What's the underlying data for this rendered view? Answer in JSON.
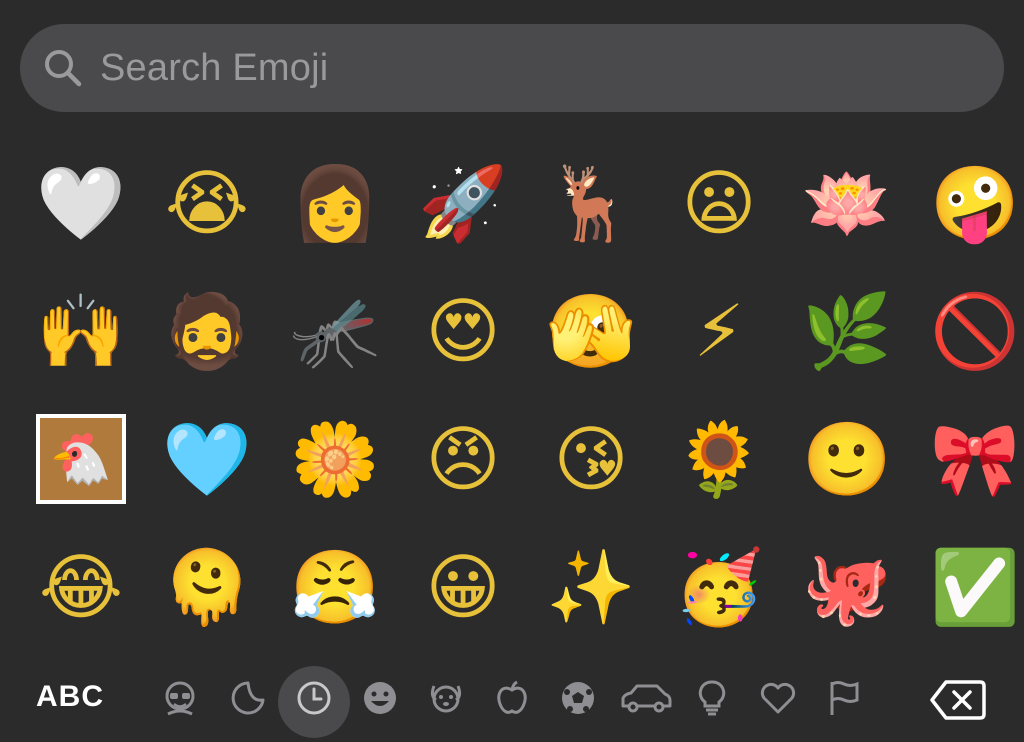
{
  "search": {
    "placeholder": "Search Emoji",
    "icon": "magnifying-glass"
  },
  "emoji_rows": [
    [
      {
        "name": "white-heart",
        "glyph": "🤍"
      },
      {
        "name": "loudly-crying-face",
        "glyph": "😭"
      },
      {
        "name": "woman-with-glasses",
        "glyph": "👩"
      },
      {
        "name": "rocket",
        "glyph": "🚀"
      },
      {
        "name": "deer",
        "glyph": "🦌"
      },
      {
        "name": "frowning-face-open-mouth",
        "glyph": "😦"
      },
      {
        "name": "lotus",
        "glyph": "🪷"
      },
      {
        "name": "zany-face",
        "glyph": "🤪"
      }
    ],
    [
      {
        "name": "raising-hands",
        "glyph": "🙌"
      },
      {
        "name": "man-with-beard",
        "glyph": "🧔"
      },
      {
        "name": "mosquito",
        "glyph": "🦟"
      },
      {
        "name": "heart-eyes-face",
        "glyph": "😍"
      },
      {
        "name": "face-with-monocle-hand",
        "glyph": "🫣"
      },
      {
        "name": "high-voltage",
        "glyph": "⚡"
      },
      {
        "name": "herb",
        "glyph": "🌿"
      },
      {
        "name": "prohibited-face",
        "glyph": "🚫"
      }
    ],
    [
      {
        "name": "custom-chicken-sticker",
        "glyph": "🐔"
      },
      {
        "name": "light-blue-heart",
        "glyph": "🩵"
      },
      {
        "name": "blossom",
        "glyph": "🌼"
      },
      {
        "name": "angry-face-hands",
        "glyph": "😠"
      },
      {
        "name": "kissing-face-heart",
        "glyph": "😘"
      },
      {
        "name": "sunflower",
        "glyph": "🌻"
      },
      {
        "name": "smiling-face-plate",
        "glyph": "🙂"
      },
      {
        "name": "ribbon",
        "glyph": "🎀"
      }
    ],
    [
      {
        "name": "face-with-tears-of-joy",
        "glyph": "😂"
      },
      {
        "name": "melting-face",
        "glyph": "🫠"
      },
      {
        "name": "messy-hair-face",
        "glyph": "😤"
      },
      {
        "name": "grinning-face",
        "glyph": "😀"
      },
      {
        "name": "sparkles",
        "glyph": "✨"
      },
      {
        "name": "celebrating-face",
        "glyph": "🥳"
      },
      {
        "name": "octopus",
        "glyph": "🐙"
      },
      {
        "name": "check-mark-button",
        "glyph": "✅"
      }
    ]
  ],
  "bottom_bar": {
    "abc_label": "ABC",
    "categories": [
      {
        "name": "memoji-icon"
      },
      {
        "name": "stickers-icon"
      },
      {
        "name": "recent-clock-icon",
        "selected": true
      },
      {
        "name": "smileys-icon"
      },
      {
        "name": "animals-icon"
      },
      {
        "name": "food-apple-icon"
      },
      {
        "name": "activity-ball-icon"
      },
      {
        "name": "travel-car-icon"
      },
      {
        "name": "objects-lightbulb-icon"
      },
      {
        "name": "symbols-heart-icon"
      },
      {
        "name": "flags-icon"
      }
    ],
    "delete_icon": "backspace"
  },
  "colors": {
    "background": "#2b2b2b",
    "search_field": "#4a4a4c",
    "icon_gray": "#8e8e93",
    "selected_bg": "#4a4a4c"
  }
}
